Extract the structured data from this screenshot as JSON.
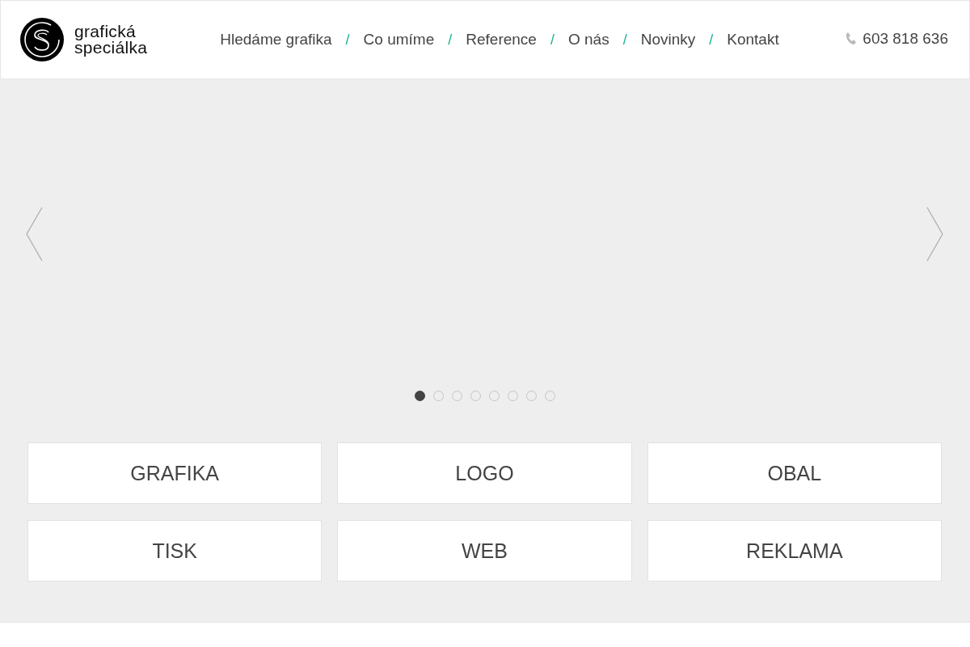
{
  "logo": {
    "line_1": "grafická",
    "line_2": "speciálka"
  },
  "nav": [
    {
      "label": "Hledáme grafika"
    },
    {
      "label": "Co umíme"
    },
    {
      "label": "Reference"
    },
    {
      "label": "O nás"
    },
    {
      "label": "Novinky"
    },
    {
      "label": "Kontakt"
    }
  ],
  "nav_separator": "/",
  "phone": "603 818 636",
  "slider": {
    "dots": [
      {
        "selected": true
      },
      {
        "selected": false
      },
      {
        "selected": false
      },
      {
        "selected": false
      },
      {
        "selected": false
      },
      {
        "selected": false
      },
      {
        "selected": false
      },
      {
        "selected": false
      }
    ]
  },
  "categories": [
    {
      "label": "GRAFIKA"
    },
    {
      "label": "LOGO"
    },
    {
      "label": "OBAL"
    },
    {
      "label": "TISK"
    },
    {
      "label": "WEB"
    },
    {
      "label": "REKLAMA"
    }
  ]
}
